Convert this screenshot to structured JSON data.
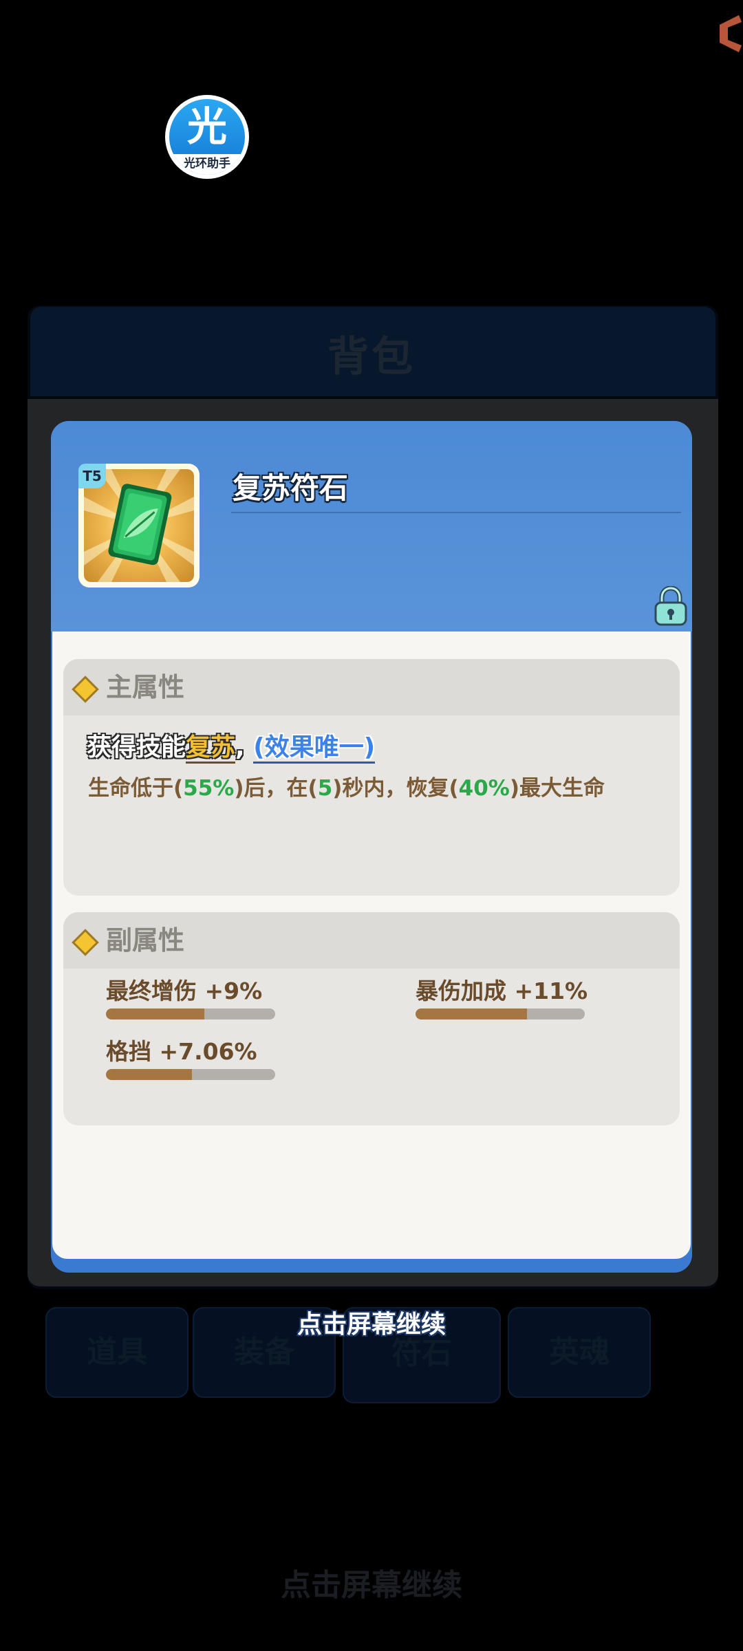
{
  "helper": {
    "glyph": "光",
    "label": "光环助手"
  },
  "backpack": {
    "title": "背包",
    "tabs": [
      "道具",
      "装备",
      "符石",
      "英魂"
    ],
    "bottom_hint": "点击屏幕继续"
  },
  "item": {
    "tier": "T5",
    "name": "复苏符石",
    "locked": true,
    "main_attr": {
      "title": "主属性",
      "skill_prefix": "获得技能",
      "skill_name": "复苏",
      "skill_sep": ",",
      "skill_unique": "(效果唯一)",
      "effect": {
        "p1": "生命低于(",
        "v1": "55%",
        "p2": ")后，在(",
        "v2": "5",
        "p3": ")秒内，恢复(",
        "v3": "40%",
        "p4": ")最大生命"
      }
    },
    "sub_attr": {
      "title": "副属性",
      "stats": [
        {
          "label": "最终增伤 +9%",
          "fill": 0.58
        },
        {
          "label": "暴伤加成 +11%",
          "fill": 0.66
        },
        {
          "label": "格挡 +7.06%",
          "fill": 0.51
        }
      ]
    }
  },
  "continue_text": "点击屏幕继续",
  "colors": {
    "card_blue": "#4d8ad6",
    "highlight_green": "#2aa84a",
    "skill_gold": "#f2c035",
    "unique_blue": "#3c82e8",
    "stat_text": "#6a4b2c"
  },
  "icons": [
    "helper-badge-icon",
    "rune-card-icon",
    "lock-icon",
    "diamond-bullet-icon",
    "corner-arrow-icon"
  ]
}
